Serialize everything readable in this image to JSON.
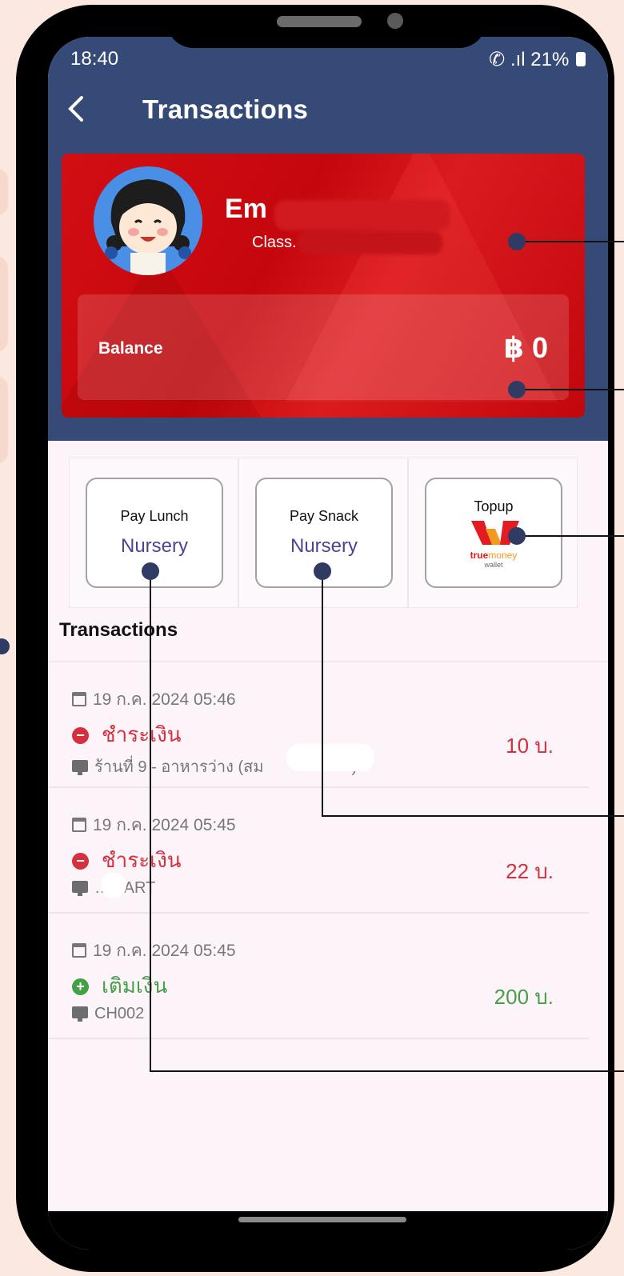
{
  "status_bar": {
    "time": "18:40",
    "battery": "21%"
  },
  "header": {
    "back_icon": "chevron-left-icon",
    "title": "Transactions"
  },
  "profile": {
    "name": "Em",
    "class_label": "Class.",
    "balance_label": "Balance",
    "balance_value": "฿ 0"
  },
  "actions": [
    {
      "top": "Pay Lunch",
      "bottom": "Nursery"
    },
    {
      "top": "Pay Snack",
      "bottom": "Nursery"
    },
    {
      "top": "Topup",
      "logo": "truemoney wallet",
      "brand_a": "true",
      "brand_b": "money",
      "wallet": "wallet"
    }
  ],
  "transactions_title": "Transactions",
  "transactions": [
    {
      "date": "19 ก.ค. 2024 05:46",
      "type": "ชำระเงิน",
      "note": "ร้านที่ 9 - อาหารว่าง (สม",
      "note_end": "ี)",
      "amount": "10 บ.",
      "kind": "pay"
    },
    {
      "date": "19 ก.ค. 2024 05:45",
      "type": "ชำระเงิน",
      "note": "…MART",
      "amount": "22 บ.",
      "kind": "pay"
    },
    {
      "date": "19 ก.ค. 2024 05:45",
      "type": "เติมเงิน",
      "note": "CH002",
      "amount": "200 บ.",
      "kind": "topup"
    }
  ],
  "colors": {
    "app_bar": "#364a78",
    "card_red": "#d20e13",
    "pay": "#d5303d",
    "topup": "#44a046",
    "accent_text": "#4a4495",
    "callout": "#2f3b63"
  }
}
